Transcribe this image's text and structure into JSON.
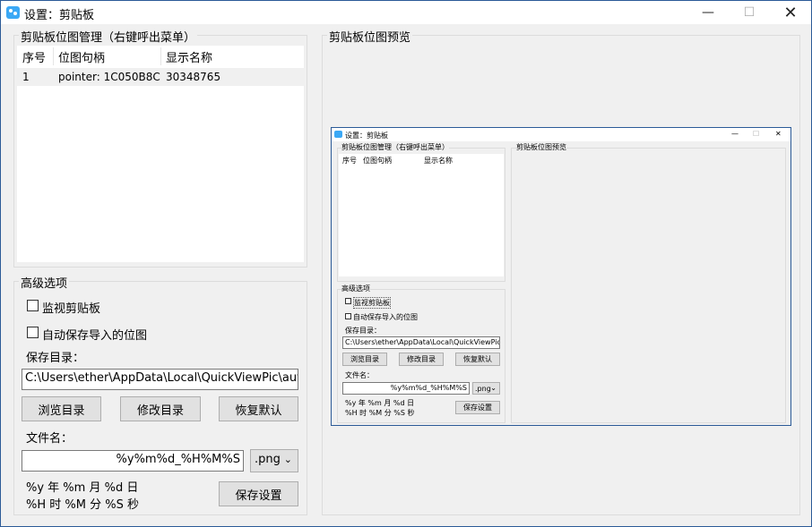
{
  "window": {
    "title": "设置：剪贴板",
    "minimize_glyph": "—",
    "maximize_glyph": "☐",
    "close_glyph": "✕",
    "icon": "clipboard-app-icon"
  },
  "bitmap_group": {
    "label": "剪贴板位图管理（右键呼出菜单）",
    "columns": [
      "序号",
      "位图句柄",
      "显示名称"
    ],
    "rows": [
      {
        "index": "1",
        "handle": "pointer: 1C050B8C",
        "name": "30348765"
      }
    ]
  },
  "advanced": {
    "label": "高级选项",
    "monitor_clipboard": "监视剪贴板",
    "auto_save": "自动保存导入的位图",
    "save_dir_label": "保存目录：",
    "save_dir_value": "C:\\Users\\ether\\AppData\\Local\\QuickViewPic\\auto",
    "browse_button": "浏览目录",
    "modify_button": "修改目录",
    "restore_button": "恢复默认",
    "filename_label": "文件名：",
    "filename_value": "%y%m%d_%H%M%S",
    "extension_value": ".png",
    "hint_line1": "%y 年 %m 月 %d 日",
    "hint_line2": "%H 时 %M 分 %S 秒",
    "save_settings_button": "保存设置"
  },
  "preview": {
    "label": "剪贴板位图预览",
    "mini": {
      "title": "设置：剪贴板",
      "group_label": "剪贴板位图管理（右键呼出菜单）",
      "preview_label": "剪贴板位图预览",
      "col_index": "序号",
      "col_handle": "位图句柄",
      "col_name": "显示名称",
      "advanced_label": "高级选项",
      "monitor": "监视剪贴板",
      "auto_save": "自动保存导入的位图",
      "save_dir_label": "保存目录：",
      "save_dir_value": "C:\\Users\\ether\\AppData\\Local\\QuickViewPic\\auto",
      "browse": "浏览目录",
      "modify": "修改目录",
      "restore": "恢复默认",
      "filename_label": "文件名：",
      "filename_value": "%y%m%d_%H%M%S",
      "ext": ".png",
      "hint1": "%y 年 %m 月 %d 日",
      "hint2": "%H 时 %M 分 %S 秒",
      "save": "保存设置"
    }
  }
}
